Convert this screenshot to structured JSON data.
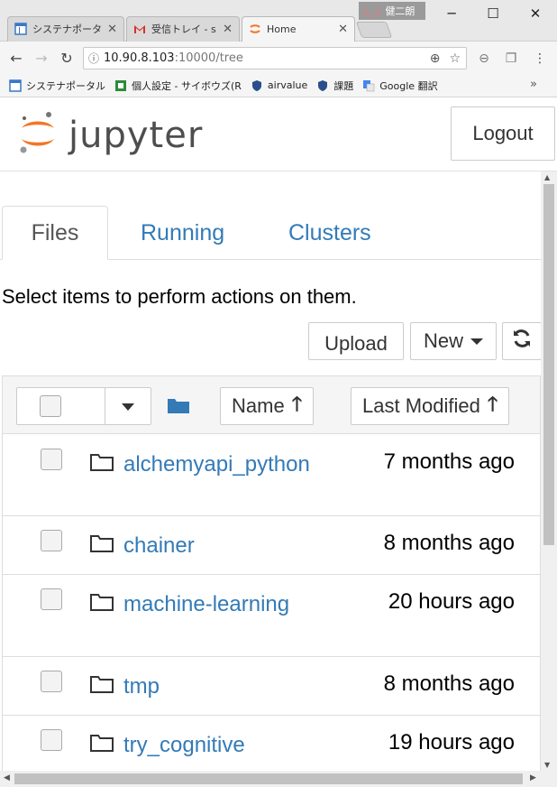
{
  "browser": {
    "tabs": [
      {
        "title": "システナポータ",
        "active": false
      },
      {
        "title": "受信トレイ - s",
        "active": false
      },
      {
        "title": "Home",
        "active": true
      }
    ],
    "user_badge": "健二朗",
    "window_controls": {
      "minimize": "─",
      "maximize": "☐",
      "close": "✕"
    },
    "url_host": "10.90.8.103",
    "url_rest": ":10000/tree",
    "bookmarks": [
      {
        "label": "システナポータル"
      },
      {
        "label": "個人設定 - サイボウズ(R"
      },
      {
        "label": "airvalue"
      },
      {
        "label": "課題"
      },
      {
        "label": "Google 翻訳"
      }
    ],
    "bookmarks_more": "»"
  },
  "header": {
    "logo_text": "jupyter",
    "logout_label": "Logout"
  },
  "tabs": {
    "files": "Files",
    "running": "Running",
    "clusters": "Clusters"
  },
  "instruction": "Select items to perform actions on them.",
  "toolbar": {
    "upload_label": "Upload",
    "new_label": "New"
  },
  "list_header": {
    "name_label": "Name",
    "last_modified_label": "Last Modified"
  },
  "files": [
    {
      "name": "alchemyapi_python",
      "modified": "7 months ago",
      "type": "folder"
    },
    {
      "name": "chainer",
      "modified": "8 months ago",
      "type": "folder"
    },
    {
      "name": "machine-learning",
      "modified": "20 hours ago",
      "type": "folder"
    },
    {
      "name": "tmp",
      "modified": "8 months ago",
      "type": "folder"
    },
    {
      "name": "try_cognitive",
      "modified": "19 hours ago",
      "type": "folder"
    }
  ],
  "colors": {
    "link": "#337ab7",
    "jupyter_orange": "#f37626",
    "folder_blue": "#337ab7"
  }
}
